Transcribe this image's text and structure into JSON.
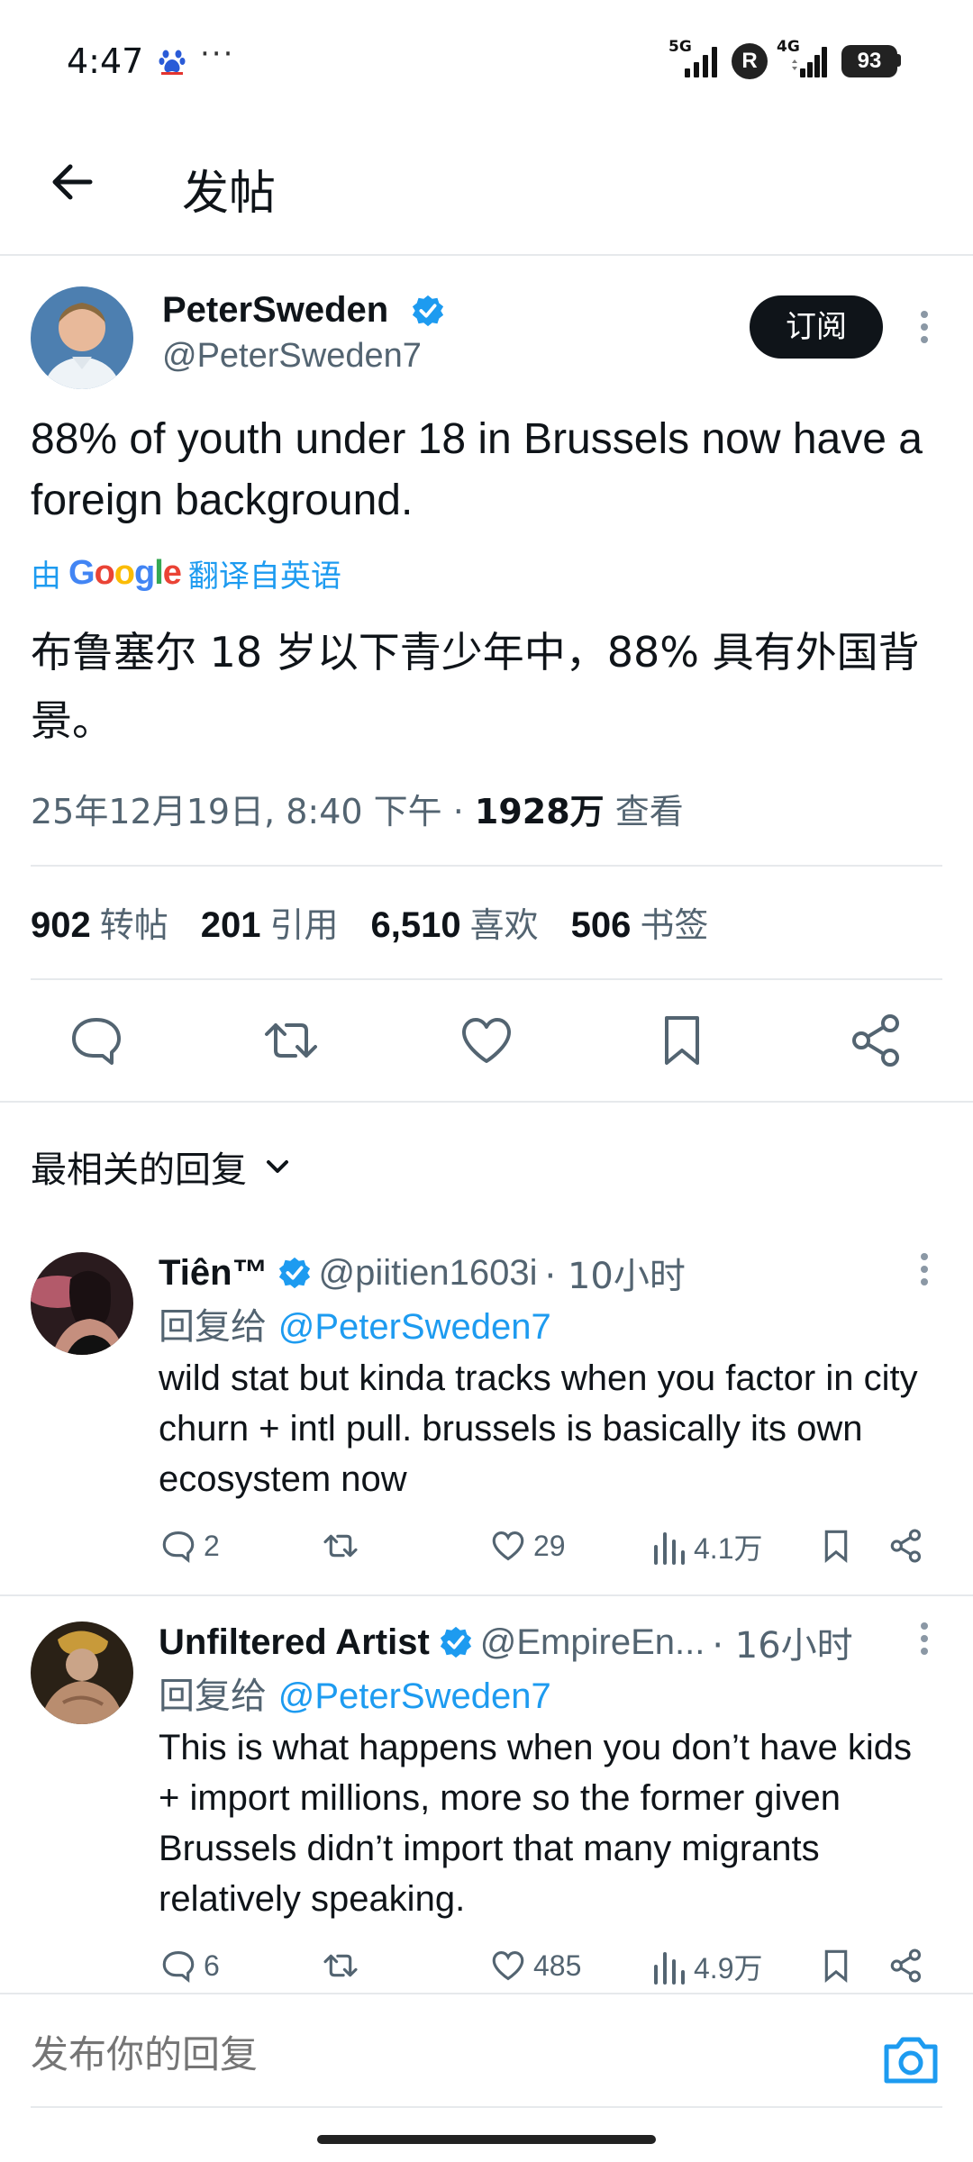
{
  "status_bar": {
    "time": "4:47",
    "dots": "···",
    "net1": "5G",
    "net2": "4G",
    "r_badge": "R",
    "battery": "93"
  },
  "header": {
    "back_icon": "arrow-left-icon",
    "title": "发帖"
  },
  "post": {
    "author_name": "PeterSweden",
    "author_handle": "@PeterSweden7",
    "subscribe_label": "订阅",
    "text": "88% of youth under 18 in Brussels now have a foreign background.",
    "translate_prefix": "由",
    "translate_brand": "Google",
    "translate_suffix": "翻译自英语",
    "translated_text": "布鲁塞尔 18 岁以下青少年中，88% 具有外国背景。",
    "timestamp": "25年12月19日, 8:40 下午 · ",
    "views_count": "1928万",
    "views_label": " 查看",
    "stats": [
      {
        "num": "902",
        "label": "转帖"
      },
      {
        "num": "201",
        "label": "引用"
      },
      {
        "num": "6,510",
        "label": "喜欢"
      },
      {
        "num": "506",
        "label": "书签"
      }
    ]
  },
  "sort": {
    "label": "最相关的回复"
  },
  "replies": [
    {
      "name": "Tiên™",
      "handle": "@piitien1603i",
      "time": "· 10小时",
      "reply_prefix": "回复给 ",
      "reply_to": "@PeterSweden7",
      "text": "wild stat but kinda tracks when you factor in city churn + intl pull. brussels is basically its own ecosystem now",
      "replies": "2",
      "reposts": "",
      "likes": "29",
      "views": "4.1万"
    },
    {
      "name": "Unfiltered Artist",
      "handle": "@EmpireEn...",
      "time": "· 16小时",
      "reply_prefix": "回复给 ",
      "reply_to": "@PeterSweden7",
      "text": "This is what happens when you don’t have kids + import millions, more so the former given Brussels didn’t import that many migrants relatively speaking.",
      "replies": "6",
      "reposts": "",
      "likes": "485",
      "views": "4.9万"
    }
  ],
  "composer": {
    "placeholder": "发布你的回复"
  },
  "colors": {
    "accent": "#1d9bf0",
    "text": "#0f1419",
    "muted": "#536471",
    "divider": "#e6e9ec"
  }
}
